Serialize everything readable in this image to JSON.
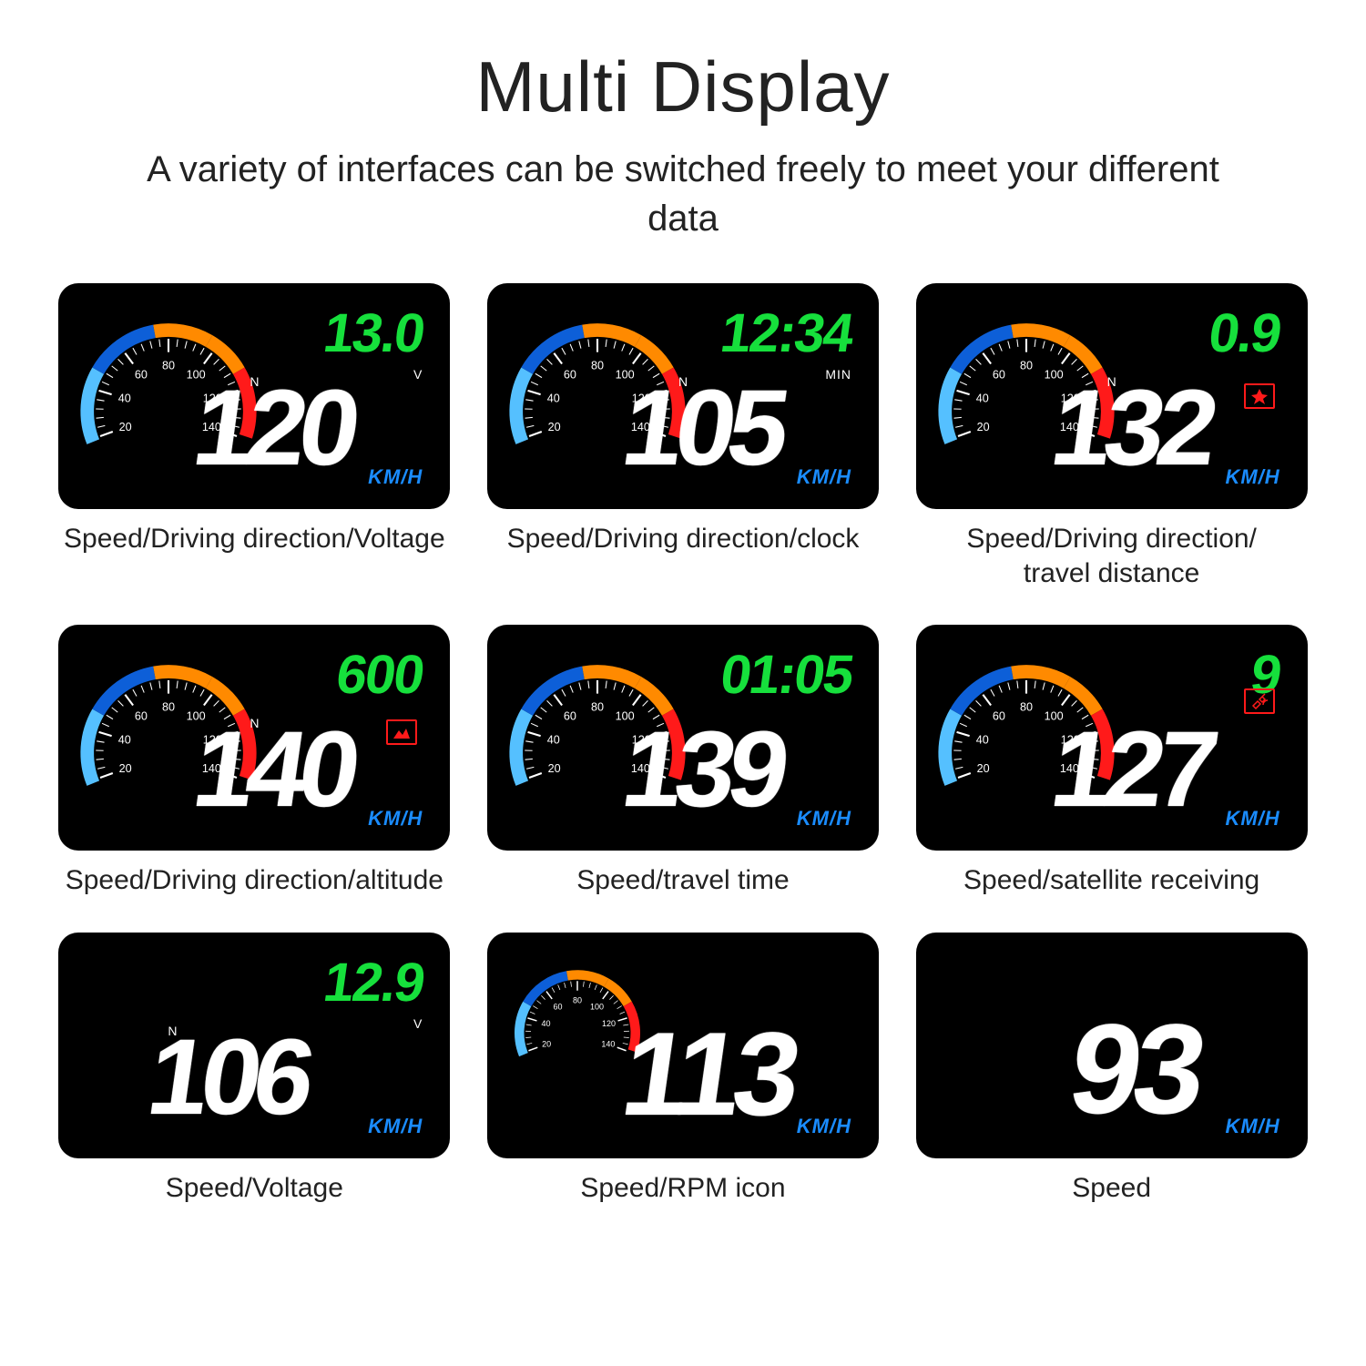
{
  "title": "Multi Display",
  "subtitle": "A variety of interfaces can be switched freely to meet your different data",
  "km_label": "KM/H",
  "n_label": "N",
  "v_label": "V",
  "min_label": "MIN",
  "panels": [
    {
      "speed": "120",
      "green": "13.0",
      "caption": "Speed/Driving direction/Voltage",
      "gauge": true,
      "showN": true,
      "showV": true,
      "showKM": true,
      "icon": null,
      "showMin": false
    },
    {
      "speed": "105",
      "green": "12:34",
      "caption": "Speed/Driving direction/clock",
      "gauge": true,
      "showN": true,
      "showV": false,
      "showKM": true,
      "icon": null,
      "showMin": true
    },
    {
      "speed": "132",
      "green": "0.9",
      "caption": "Speed/Driving direction/\ntravel distance",
      "gauge": true,
      "showN": true,
      "showV": false,
      "showKM": true,
      "icon": "gps",
      "showMin": false
    },
    {
      "speed": "140",
      "green": "600",
      "caption": "Speed/Driving direction/altitude",
      "gauge": true,
      "showN": true,
      "showV": false,
      "showKM": true,
      "icon": "alt",
      "showMin": false
    },
    {
      "speed": "139",
      "green": "01:05",
      "caption": "Speed/travel time",
      "gauge": true,
      "showN": false,
      "showV": false,
      "showKM": true,
      "icon": null,
      "showMin": false
    },
    {
      "speed": "127",
      "green": "9",
      "caption": "Speed/satellite receiving",
      "gauge": true,
      "showN": false,
      "showV": false,
      "showKM": true,
      "icon": "sat",
      "showMin": false
    },
    {
      "speed": "106",
      "green": "12.9",
      "caption": "Speed/Voltage",
      "gauge": false,
      "showN": true,
      "showV": true,
      "showKM": true,
      "icon": null,
      "showMin": false,
      "layout": "novgauge"
    },
    {
      "speed": "113",
      "green": "",
      "caption": "Speed/RPM icon",
      "gauge": true,
      "showN": false,
      "showV": false,
      "showKM": true,
      "icon": null,
      "showMin": false,
      "gaugeSmall": true,
      "layout": "center"
    },
    {
      "speed": "93",
      "green": "",
      "caption": "Speed",
      "gauge": false,
      "showN": false,
      "showV": false,
      "showKM": true,
      "icon": null,
      "showMin": false,
      "layout": "alone"
    }
  ]
}
